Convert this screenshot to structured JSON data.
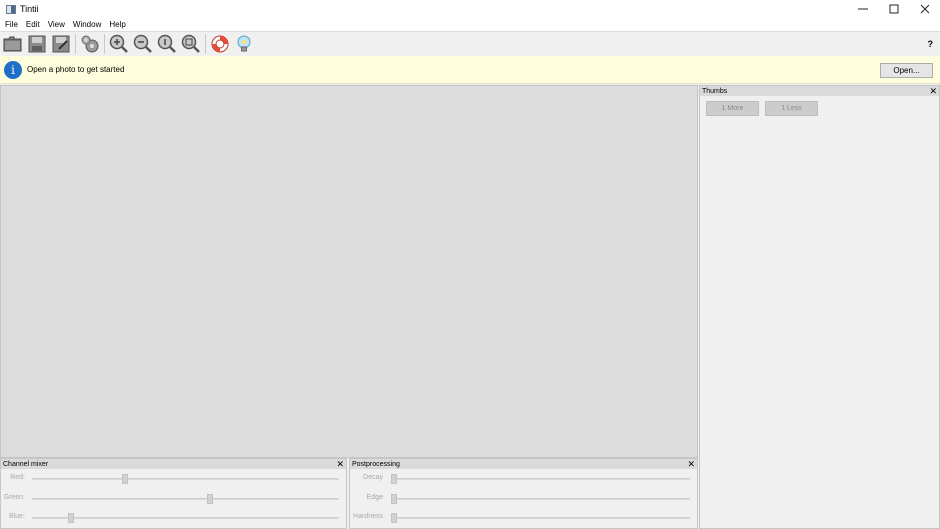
{
  "window": {
    "title": "Tintii",
    "controls": [
      "minimize-icon",
      "maximize-icon",
      "close-icon"
    ]
  },
  "menu": [
    "File",
    "Edit",
    "View",
    "Window",
    "Help"
  ],
  "toolbar": {
    "buttons": [
      {
        "name": "open-icon",
        "enabled": true
      },
      {
        "name": "save-icon",
        "enabled": false
      },
      {
        "name": "save-as-icon",
        "enabled": false
      },
      {
        "name": "settings-icon",
        "enabled": false
      },
      {
        "name": "zoom-in-icon",
        "enabled": false
      },
      {
        "name": "zoom-out-icon",
        "enabled": false
      },
      {
        "name": "zoom-100-icon",
        "enabled": false
      },
      {
        "name": "zoom-fit-icon",
        "enabled": false
      },
      {
        "name": "help-lifebuoy-icon",
        "enabled": true
      },
      {
        "name": "tip-lightbulb-icon",
        "enabled": true
      }
    ],
    "help_label": "?"
  },
  "infobar": {
    "icon": "info-icon",
    "message": "Open a photo to get started",
    "open_button": "Open..."
  },
  "thumbs": {
    "title": "Thumbs",
    "close": "✕",
    "more_button": "1 More",
    "less_button": "1 Less"
  },
  "channel_mixer": {
    "title": "Channel mixer",
    "close": "✕",
    "sliders": [
      {
        "label": "Red:",
        "value": 0.3
      },
      {
        "label": "Green:",
        "value": 0.58
      },
      {
        "label": "Blue:",
        "value": 0.12
      }
    ]
  },
  "postprocessing": {
    "title": "Postprocessing",
    "close": "✕",
    "sliders": [
      {
        "label": "Decay",
        "value": 0.0
      },
      {
        "label": "Edge",
        "value": 0.0
      },
      {
        "label": "Hardness",
        "value": 0.0
      }
    ]
  },
  "colors": {
    "info_bg": "#fefedf",
    "info_icon": "#1f6ec7",
    "canvas_bg": "#dcdcdc"
  }
}
